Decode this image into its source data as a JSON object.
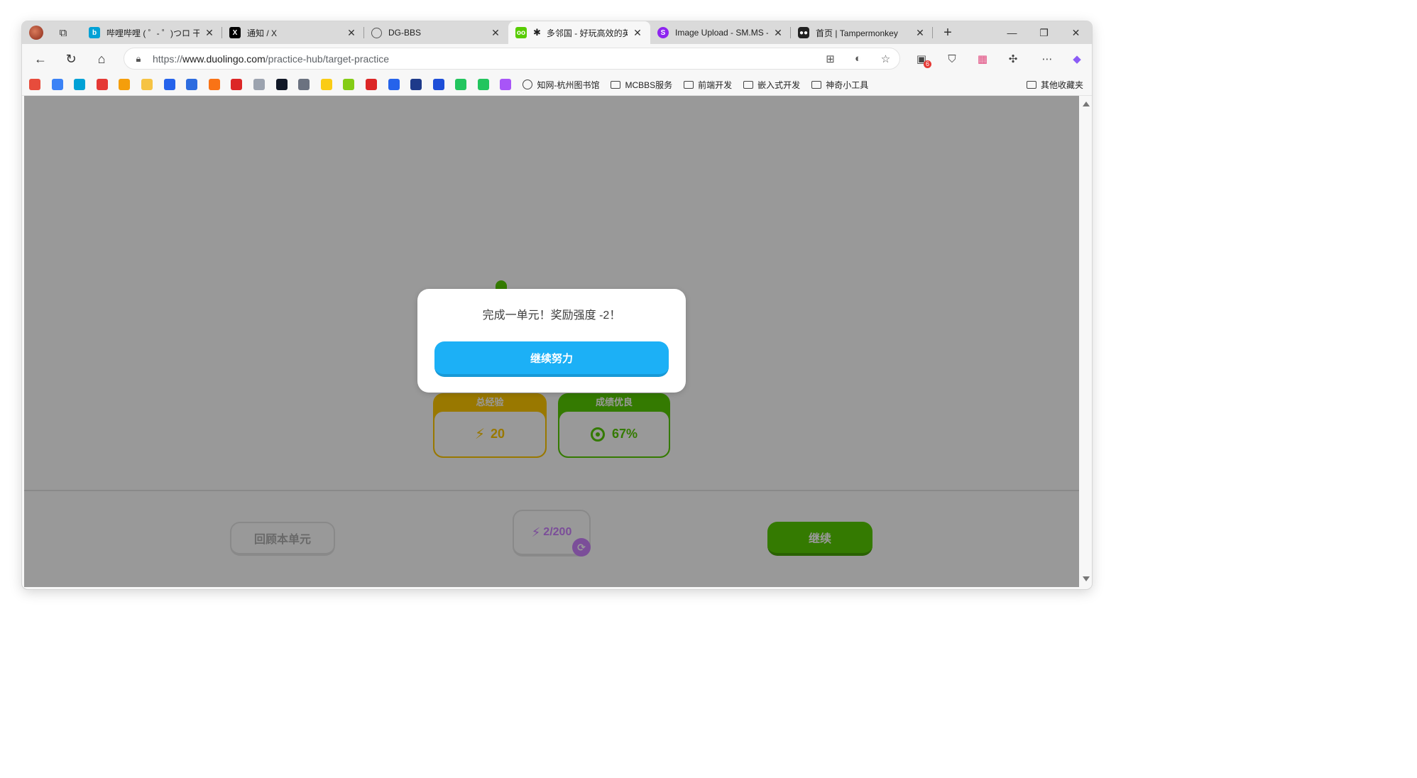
{
  "browser": {
    "tabs": [
      {
        "title": "哔哩哔哩 ( ゜- ゜)つロ 干杯~",
        "favicon": "bilibili-icon",
        "color": "#00a1d6"
      },
      {
        "title": "通知 / X",
        "favicon": "x-icon",
        "color": "#000000"
      },
      {
        "title": "DG-BBS",
        "favicon": "globe-icon",
        "color": "#666666"
      },
      {
        "title": "多邻国 - 好玩高效的英",
        "favicon": "duolingo-icon",
        "color": "#58cc02",
        "active": true
      },
      {
        "title": "Image Upload - SM.MS - Si",
        "favicon": "smms-icon",
        "color": "#8e24f0"
      },
      {
        "title": "首页 | Tampermonkey",
        "favicon": "tampermonkey-icon",
        "color": "#222222"
      }
    ],
    "new_tab": "+",
    "window_controls": {
      "minimize": "—",
      "restore": "❐",
      "close": "✕"
    },
    "address": {
      "prefix": "https://",
      "host": "www.duolingo.com",
      "path": "/practice-hub/target-practice"
    },
    "extension_badge": "6",
    "bookmark_icon_colors": [
      "#e74c3c",
      "#3b82f6",
      "#00a1d6",
      "#e53935",
      "#f59e0b",
      "#f6c343",
      "#2563eb",
      "#2d6cdf",
      "#f97316",
      "#dc2626",
      "#9ca3af",
      "#111827",
      "#6b7280",
      "#facc15",
      "#84cc16",
      "#dc2626",
      "#2563eb",
      "#1e3a8a",
      "#1d4ed8",
      "#22c55e",
      "#22c55e",
      "#a855f7"
    ],
    "bookmark_folders": [
      {
        "label": "知网-杭州图书馆",
        "type": "globe"
      },
      {
        "label": "MCBBS服务",
        "type": "folder"
      },
      {
        "label": "前端开发",
        "type": "folder"
      },
      {
        "label": "嵌入式开发",
        "type": "folder"
      },
      {
        "label": "神奇小工具",
        "type": "folder"
      }
    ],
    "other_bookmarks": "其他收藏夹"
  },
  "lesson": {
    "stats": [
      {
        "label": "总经验",
        "value": "20",
        "color": "#ffc800"
      },
      {
        "label": "成绩优良",
        "value": "67%",
        "color": "#58cc02"
      }
    ],
    "review_button": "回顾本单元",
    "counter": "2/200",
    "continue_button": "继续"
  },
  "modal": {
    "message": "完成一单元！奖励强度 -2！",
    "button": "继续努力"
  }
}
